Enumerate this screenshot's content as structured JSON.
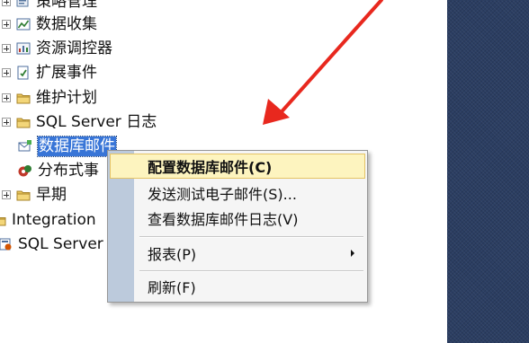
{
  "tree": {
    "nodes": [
      {
        "label": "策略管理",
        "icon": "policy-icon",
        "expander": true
      },
      {
        "label": "数据收集",
        "icon": "data-collection-icon",
        "expander": true
      },
      {
        "label": "资源调控器",
        "icon": "resource-governor-icon",
        "expander": true
      },
      {
        "label": "扩展事件",
        "icon": "extended-events-icon",
        "expander": true
      },
      {
        "label": "维护计划",
        "icon": "folder-icon",
        "expander": true
      },
      {
        "label": "SQL Server 日志",
        "icon": "folder-icon",
        "expander": true
      },
      {
        "label": "数据库邮件",
        "icon": "database-mail-icon",
        "expander": false,
        "selected": true
      },
      {
        "label": "分布式事",
        "icon": "distributed-transaction-icon",
        "expander": false
      },
      {
        "label": "早期",
        "icon": "folder-icon",
        "expander": true
      },
      {
        "label": "Integration",
        "icon": "folder-icon",
        "expander": false
      },
      {
        "label": "SQL Server",
        "icon": "sql-agent-icon",
        "expander": false
      }
    ]
  },
  "context_menu": {
    "items": [
      {
        "label": "配置数据库邮件(C)",
        "highlighted": true
      },
      {
        "label": "发送测试电子邮件(S)..."
      },
      {
        "label": "查看数据库邮件日志(V)"
      },
      {
        "label": "报表(P)",
        "submenu": true
      },
      {
        "label": "刷新(F)"
      }
    ]
  },
  "colors": {
    "selection": "#3875d7",
    "menu_highlight": "#fdf4bf",
    "menu_gutter": "#bccadc",
    "annotation_arrow": "#e8281e",
    "right_panel": "#2b3e62"
  }
}
